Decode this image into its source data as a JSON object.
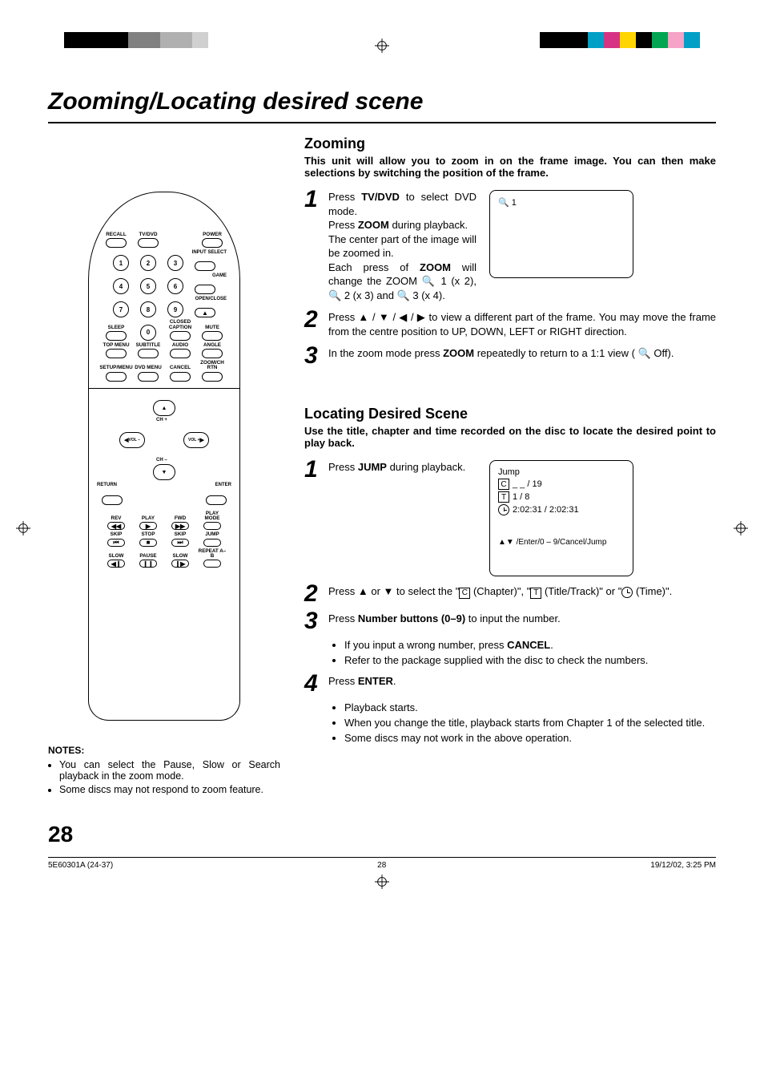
{
  "pageTitle": "Zooming/Locating desired scene",
  "pageNumber": "28",
  "footer": {
    "left": "5E60301A (24-37)",
    "center": "28",
    "right": "19/12/02, 3:25 PM"
  },
  "remote": {
    "labels": {
      "recall": "RECALL",
      "tvdvd": "TV/DVD",
      "power": "POWER",
      "inputSelect": "INPUT SELECT",
      "game": "GAME",
      "openClose": "OPEN/CLOSE",
      "sleep": "SLEEP",
      "closedCaption": "CLOSED\nCAPTION",
      "mute": "MUTE",
      "topMenu": "TOP MENU",
      "subtitle": "SUBTITLE",
      "audio": "AUDIO",
      "angle": "ANGLE",
      "setupMenu": "SETUP/MENU",
      "dvdMenu": "DVD MENU",
      "cancel": "CANCEL",
      "zoomChRtn": "ZOOM/CH RTN",
      "chPlus": "CH +",
      "chMinus": "CH –",
      "volMinus": "VOL –",
      "volPlus": "VOL +",
      "return": "RETURN",
      "enter": "ENTER",
      "rev": "REV",
      "play": "PLAY",
      "fwd": "FWD",
      "playMode": "PLAY MODE",
      "skipL": "SKIP",
      "stop": "STOP",
      "skipR": "SKIP",
      "jump": "JUMP",
      "slowL": "SLOW",
      "pause": "PAUSE",
      "slowR": "SLOW",
      "repeat": "REPEAT A–B"
    },
    "digits": [
      "1",
      "2",
      "3",
      "4",
      "5",
      "6",
      "7",
      "8",
      "9",
      "0"
    ]
  },
  "notes": {
    "heading": "NOTES:",
    "items": [
      "You can select the Pause, Slow or Search playback in the zoom mode.",
      "Some discs may not respond to zoom feature."
    ]
  },
  "zooming": {
    "heading": "Zooming",
    "lead": "This unit will allow you to zoom in on the frame image. You can then make selections by switching the position of the frame.",
    "step1": {
      "l1": "Press ",
      "l1b": "TV/DVD",
      "l1c": " to select DVD mode.",
      "l2a": "Press ",
      "l2b": "ZOOM",
      "l2c": " during playback.",
      "l3": "The center part of the image will be zoomed in.",
      "l4a": "Each press of ",
      "l4b": "ZOOM",
      "l4c": " will change the ZOOM ",
      "mag": "🔍",
      "l4d": "1 (x 2), ",
      "l4e": "2 (x 3) and ",
      "l4f": "3 (x 4).",
      "osd": "🔍 1"
    },
    "step2": {
      "a": "Press ",
      "b": " to view a different part of the frame. You may move the frame from the centre position to UP, DOWN, LEFT or RIGHT direction."
    },
    "step3": {
      "a": "In the zoom mode press ",
      "b": "ZOOM",
      "c": " repeatedly to return to a 1:1 view (",
      "d": " Off)."
    }
  },
  "locating": {
    "heading": "Locating Desired Scene",
    "lead": "Use the title, chapter and time recorded on the disc to locate the desired point to play back.",
    "step1": {
      "a": "Press ",
      "b": "JUMP",
      "c": " during playback.",
      "osd": {
        "title": "Jump",
        "chapter": "_ _ / 19",
        "titleTrack": "1 / 8",
        "time": "2:02:31 / 2:02:31",
        "footer": "▲▼ /Enter/0 – 9/Cancel/Jump"
      }
    },
    "step2": {
      "a": "Press ",
      "b": " or ",
      "c": " to select the \"",
      "d": " (Chapter)\", \"",
      "e": " (Title/Track)\" or \"",
      "f": " (Time)\"."
    },
    "step3": {
      "a": "Press ",
      "b": "Number buttons (0–9)",
      "c": " to input the number.",
      "bullets": [
        "If you input a wrong number, press CANCEL.",
        "Refer to the package supplied with the disc to check the numbers."
      ],
      "cancelBold": "CANCEL"
    },
    "step4": {
      "a": "Press ",
      "b": "ENTER",
      "c": ".",
      "bullets": [
        "Playback starts.",
        "When you change the title, playback starts from Chapter 1 of the selected title.",
        "Some discs may not work in the above operation."
      ]
    }
  }
}
